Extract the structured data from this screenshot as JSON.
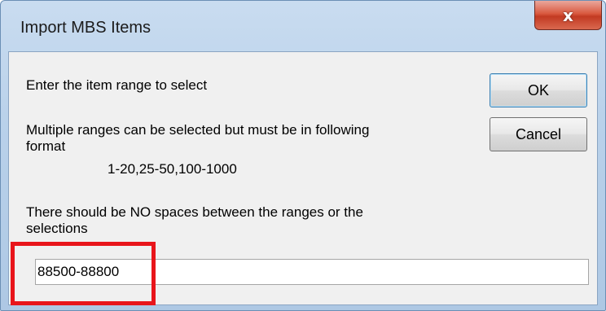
{
  "window": {
    "title": "Import MBS Items",
    "close_glyph": "x"
  },
  "dialog": {
    "instruction": "Enter the item range to select",
    "format_line1": "Multiple ranges can be selected but must be in following",
    "format_line2": "format",
    "format_example": "1-20,25-50,100-1000",
    "note_line1": "There should be NO spaces between the ranges or the",
    "note_line2": "selections"
  },
  "buttons": {
    "ok_label": "OK",
    "cancel_label": "Cancel"
  },
  "range_input": {
    "value": "88500-88800"
  },
  "annotation": {
    "highlight_color": "#e8151b"
  }
}
